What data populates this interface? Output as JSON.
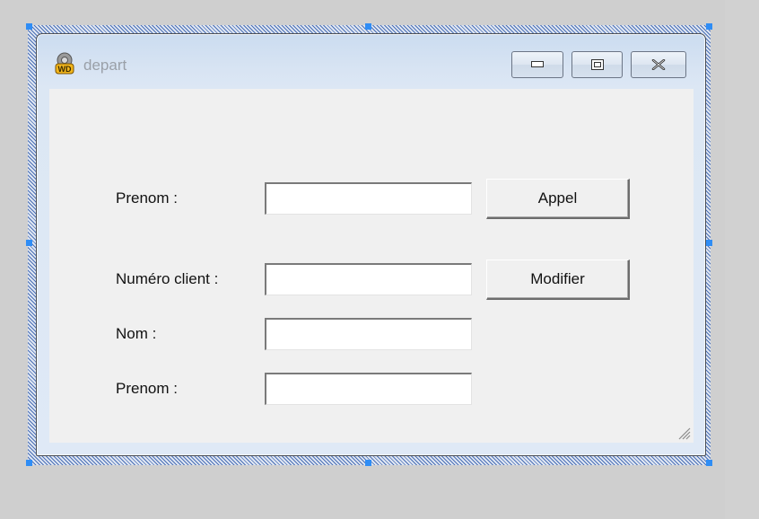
{
  "window": {
    "title": "depart",
    "icon": "windev-wd-icon",
    "controls": [
      "minimize-icon",
      "maximize-icon",
      "close-icon"
    ]
  },
  "form": {
    "prenom_top_label": "Prenom :",
    "prenom_top_value": "",
    "appel_button": "Appel",
    "numero_client_label": "Numéro client :",
    "numero_client_value": "",
    "modifier_button": "Modifier",
    "nom_label": "Nom :",
    "nom_value": "",
    "prenom_bottom_label": "Prenom :",
    "prenom_bottom_value": ""
  },
  "colors": {
    "selection_handle": "#2f8df5",
    "client_background": "#f0f0f0"
  }
}
